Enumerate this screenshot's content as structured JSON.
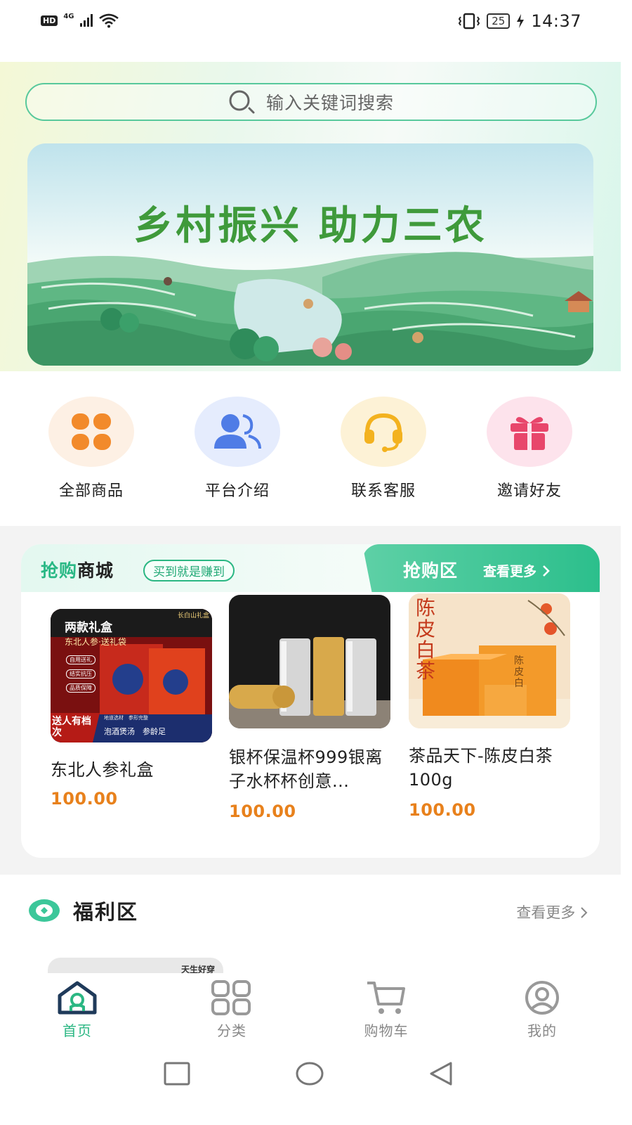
{
  "status_bar": {
    "hd": "HD",
    "network": "4G",
    "battery": "25",
    "time": "14:37"
  },
  "search": {
    "placeholder": "输入关键词搜索"
  },
  "banner": {
    "headline": "乡村振兴 助力三农"
  },
  "quick_nav": [
    {
      "label": "全部商品",
      "icon": "grid-icon",
      "bg": "#fdf0e4",
      "color": "#f28a2b"
    },
    {
      "label": "平台介绍",
      "icon": "users-icon",
      "bg": "#e5ecfd",
      "color": "#4f7ce6"
    },
    {
      "label": "联系客服",
      "icon": "headset-icon",
      "bg": "#fdf2d6",
      "color": "#f3b21f"
    },
    {
      "label": "邀请好友",
      "icon": "gift-icon",
      "bg": "#fde3ec",
      "color": "#e8466b"
    }
  ],
  "flash_sale": {
    "title_accent": "抢购",
    "title_rest": "商城",
    "slogan": "买到就是赚到",
    "zone_title": "抢购区",
    "more_label": "查看更多",
    "products": [
      {
        "name": "东北人参礼盒",
        "price": "100.00",
        "image_text": {
          "corner": "长白山礼盒",
          "headline": "两款礼盒",
          "sub": "东北人参·送礼袋",
          "tags": [
            "自用送礼",
            "结实抗压",
            "品质保障"
          ],
          "bottom_left": "送人有档次",
          "bottom_line1": "地道选材　参形完整",
          "bottom_line2": "泡酒煲汤　参龄足"
        }
      },
      {
        "name": "银杯保温杯999银离子水杯杯创意...",
        "price": "100.00"
      },
      {
        "name": "茶品天下-陈皮白茶100g",
        "price": "100.00",
        "image_text": {
          "vertical": "陈皮白茶",
          "box_text": "陈皮白"
        }
      }
    ]
  },
  "welfare": {
    "title": "福利区",
    "more_label": "查看更多",
    "peek_text": "天生好穿"
  },
  "tab_bar": [
    {
      "label": "首页",
      "icon": "home-icon",
      "active": true
    },
    {
      "label": "分类",
      "icon": "category-icon",
      "active": false
    },
    {
      "label": "购物车",
      "icon": "cart-icon",
      "active": false
    },
    {
      "label": "我的",
      "icon": "profile-icon",
      "active": false
    }
  ],
  "colors": {
    "brand_green": "#2bb783",
    "price_orange": "#e8811c"
  }
}
